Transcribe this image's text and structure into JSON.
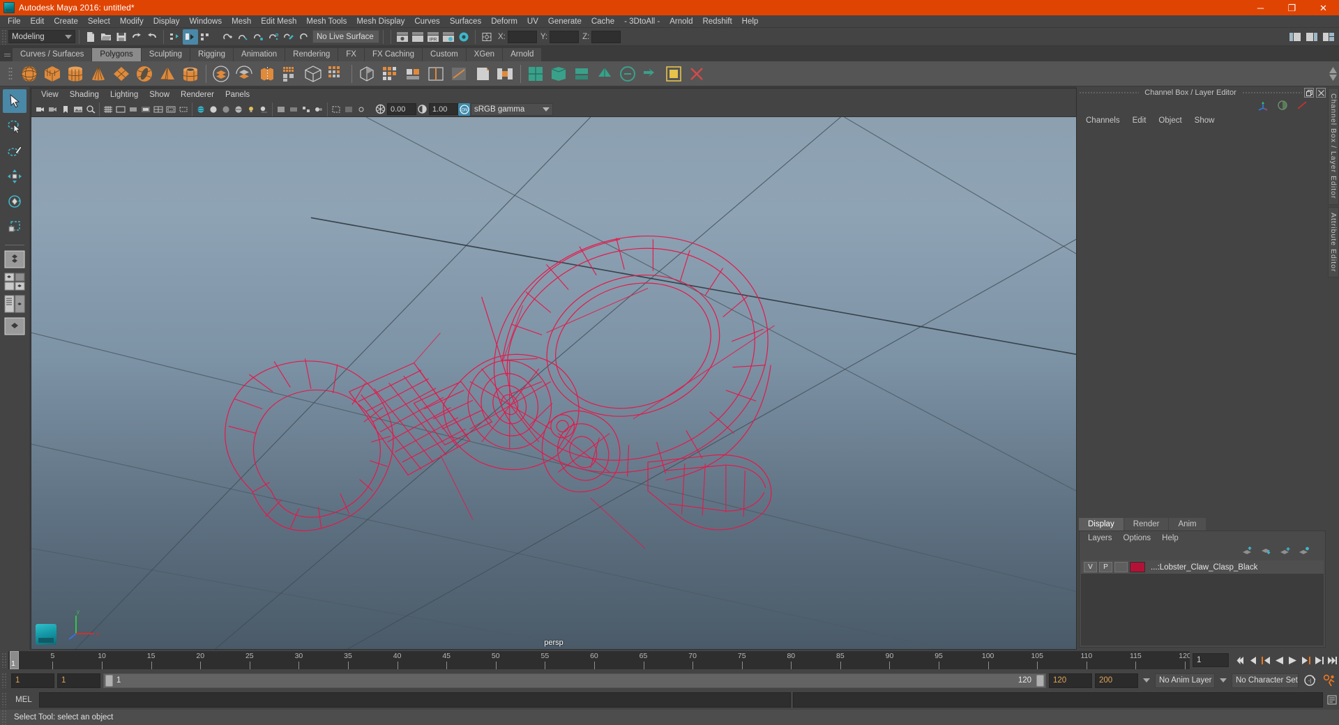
{
  "window": {
    "title": "Autodesk Maya 2016: untitled*",
    "logo_icon": "maya-logo-icon",
    "minimize_label": "─",
    "maximize_label": "❐",
    "close_label": "✕"
  },
  "menubar": {
    "items": [
      {
        "label": "File"
      },
      {
        "label": "Edit"
      },
      {
        "label": "Create"
      },
      {
        "label": "Select"
      },
      {
        "label": "Modify"
      },
      {
        "label": "Display"
      },
      {
        "label": "Windows"
      },
      {
        "label": "Mesh"
      },
      {
        "label": "Edit Mesh"
      },
      {
        "label": "Mesh Tools"
      },
      {
        "label": "Mesh Display"
      },
      {
        "label": "Curves"
      },
      {
        "label": "Surfaces"
      },
      {
        "label": "Deform"
      },
      {
        "label": "UV"
      },
      {
        "label": "Generate"
      },
      {
        "label": "Cache"
      },
      {
        "label": "- 3DtoAll -"
      },
      {
        "label": "Arnold"
      },
      {
        "label": "Redshift"
      },
      {
        "label": "Help"
      }
    ]
  },
  "statusline": {
    "menuset": "Modeling",
    "live_surface": "No Live Surface",
    "coord_x_label": "X:",
    "coord_y_label": "Y:",
    "coord_z_label": "Z:",
    "coord_x_value": "",
    "coord_y_value": "",
    "coord_z_value": "",
    "icons": [
      "new-scene-icon",
      "open-scene-icon",
      "save-scene-icon",
      "undo-icon",
      "redo-icon",
      "select-by-hierarchy-icon",
      "select-by-object-icon",
      "select-by-component-icon",
      "snap-to-grid-icon",
      "snap-to-curve-icon",
      "snap-to-point-icon",
      "snap-to-projected-center-icon",
      "snap-to-view-plane-icon",
      "make-live-icon",
      "render-current-frame-icon",
      "ipr-render-icon",
      "render-settings-icon",
      "hypershade-icon",
      "toggle-attribute-editor-icon",
      "toggle-tool-settings-icon",
      "toggle-channel-box-icon"
    ]
  },
  "shelf": {
    "tabs": [
      {
        "label": "Curves / Surfaces",
        "selected": false
      },
      {
        "label": "Polygons",
        "selected": true
      },
      {
        "label": "Sculpting",
        "selected": false
      },
      {
        "label": "Rigging",
        "selected": false
      },
      {
        "label": "Animation",
        "selected": false
      },
      {
        "label": "Rendering",
        "selected": false
      },
      {
        "label": "FX",
        "selected": false
      },
      {
        "label": "FX Caching",
        "selected": false
      },
      {
        "label": "Custom",
        "selected": false
      },
      {
        "label": "XGen",
        "selected": false
      },
      {
        "label": "Arnold",
        "selected": false
      }
    ],
    "icons": [
      "poly-sphere-icon",
      "poly-cube-icon",
      "poly-cylinder-icon",
      "poly-cone-icon",
      "poly-plane-icon",
      "poly-torus-icon",
      "poly-pyramid-icon",
      "poly-pipe-icon",
      "combine-icon",
      "separate-icon",
      "extract-icon",
      "booleans-icon",
      "smooth-icon",
      "subdiv-proxy-icon",
      "mirror-geometry-icon",
      "sculpt-geometry-icon",
      "append-polygon-icon",
      "insert-edge-loop-icon",
      "offset-edge-loop-icon",
      "multi-cut-icon",
      "bevel-icon",
      "bridge-icon",
      "wedge-icon",
      "poly-uv-icon",
      "uv-editor-icon",
      "quad-draw-icon",
      "crease-tool-icon",
      "delete-edge-icon"
    ]
  },
  "toolbox": {
    "tools": [
      {
        "name": "select-tool",
        "selected": true
      },
      {
        "name": "lasso-select-tool",
        "selected": false
      },
      {
        "name": "paint-select-tool",
        "selected": false
      },
      {
        "name": "move-tool",
        "selected": false
      },
      {
        "name": "rotate-tool",
        "selected": false
      },
      {
        "name": "scale-tool",
        "selected": false
      }
    ],
    "layouts": [
      "single-perspective-layout",
      "four-view-layout",
      "outliner-persp-layout",
      "persp-graph-layout",
      "hypershade-persp-layout",
      "persp-only-layout"
    ]
  },
  "viewport": {
    "menus": [
      {
        "label": "View"
      },
      {
        "label": "Shading"
      },
      {
        "label": "Lighting"
      },
      {
        "label": "Show"
      },
      {
        "label": "Renderer"
      },
      {
        "label": "Panels"
      }
    ],
    "exposure_value": "0.00",
    "gamma_value": "1.00",
    "color_management": "sRGB gamma",
    "color_management_toggle": "ON",
    "camera_label": "persp",
    "wireframe_color": "#e3194b",
    "toolbar_icons": [
      "select-camera-icon",
      "camera-attributes-icon",
      "bookmarks-icon",
      "image-plane-icon",
      "two-d-pan-zoom-icon",
      "grid-toggle-icon",
      "film-gate-icon",
      "resolution-gate-icon",
      "gate-mask-icon",
      "field-chart-icon",
      "safe-action-icon",
      "safe-title-icon",
      "wireframe-icon",
      "smooth-shade-icon",
      "flat-shade-icon",
      "use-all-lights-icon",
      "shadows-icon",
      "screen-space-ao-icon",
      "motion-blur-icon",
      "multisample-icon",
      "depth-of-field-icon",
      "isolate-select-icon",
      "xray-icon",
      "xray-joints-icon",
      "xray-active-components-icon",
      "exposure-icon",
      "gamma-icon",
      "color-management-icon"
    ],
    "axis_labels": {
      "x": "x",
      "y": "y",
      "z": "z"
    }
  },
  "channelbox": {
    "dock_title": "Channel Box / Layer Editor",
    "restore_icon": "restore-icon",
    "close_icon": "close-icon",
    "menus": [
      {
        "label": "Channels"
      },
      {
        "label": "Edit"
      },
      {
        "label": "Object"
      },
      {
        "label": "Show"
      }
    ],
    "mode_icons": [
      "transform-channels-icon",
      "shape-channels-icon",
      "output-channels-icon"
    ]
  },
  "layereditor": {
    "tabs": [
      {
        "label": "Display",
        "selected": true
      },
      {
        "label": "Render",
        "selected": false
      },
      {
        "label": "Anim",
        "selected": false
      }
    ],
    "menus": [
      {
        "label": "Layers"
      },
      {
        "label": "Options"
      },
      {
        "label": "Help"
      }
    ],
    "buttons": [
      "move-layer-up-icon",
      "move-layer-down-icon",
      "new-layer-icon",
      "new-layer-from-selected-icon"
    ],
    "layers": [
      {
        "visibility": "V",
        "playback": "P",
        "display_type": "",
        "color": "#b31236",
        "name": "...:Lobster_Claw_Clasp_Black"
      }
    ]
  },
  "vertical_tabs": [
    {
      "label": "Channel Box / Layer Editor"
    },
    {
      "label": "Attribute Editor"
    }
  ],
  "timeslider": {
    "start": 1,
    "end": 120,
    "current_frame": "1",
    "tick_labels": [
      "5",
      "10",
      "15",
      "20",
      "25",
      "30",
      "35",
      "40",
      "45",
      "50",
      "55",
      "60",
      "65",
      "70",
      "75",
      "80",
      "85",
      "90",
      "95",
      "100",
      "105",
      "110",
      "115",
      "120"
    ],
    "playhead_label": "1",
    "playback_buttons": [
      "go-to-start-icon",
      "step-back-keyframe-icon",
      "step-back-frame-icon",
      "play-backwards-icon",
      "play-forwards-icon",
      "step-forward-frame-icon",
      "step-forward-keyframe-icon",
      "go-to-end-icon"
    ]
  },
  "rangeslider": {
    "anim_start": "1",
    "playback_start": "1",
    "range_start_label": "1",
    "range_end_label": "120",
    "playback_end": "120",
    "anim_end": "200",
    "anim_layer": "No Anim Layer",
    "character_set": "No Character Set",
    "auto_key_icon": "auto-keyframe-icon",
    "anim_prefs_icon": "animation-preferences-icon"
  },
  "commandline": {
    "language_label": "MEL",
    "input_value": "",
    "output_value": "",
    "script_editor_icon": "script-editor-icon"
  },
  "helpline": {
    "text": "Select Tool: select an object"
  },
  "colors": {
    "accent": "#e04403",
    "panel": "#444444",
    "highlight_blue": "#4a88a8",
    "shelf_orange": "#e08a3c",
    "wire_red": "#e3194b"
  }
}
